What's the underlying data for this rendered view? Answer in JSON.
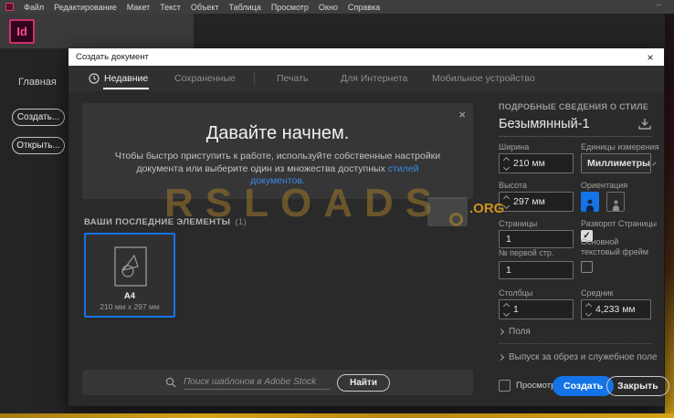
{
  "menubar": {
    "items": [
      "Файл",
      "Редактирование",
      "Макет",
      "Текст",
      "Объект",
      "Таблица",
      "Просмотр",
      "Окно",
      "Справка"
    ]
  },
  "app": {
    "logo_text": "Id"
  },
  "sidebar": {
    "home": "Главная",
    "create": "Создать...",
    "open": "Открыть..."
  },
  "dialog": {
    "title": "Создать документ",
    "tabs": [
      {
        "label": "Недавние"
      },
      {
        "label": "Сохраненные"
      },
      {
        "label": "Печать"
      },
      {
        "label": "Для Интернета"
      },
      {
        "label": "Мобильное устройство"
      }
    ],
    "hero": {
      "title": "Давайте начнем.",
      "body_line1": "Чтобы быстро приступить к работе, используйте собственные настройки",
      "body_line2": "документа или выберите один из множества доступных",
      "link_word1": "стилей",
      "link_word2": "документов."
    },
    "recents": {
      "section_label": "ВАШИ ПОСЛЕДНИЕ ЭЛЕМЕНТЫ",
      "count": "(1)",
      "item": {
        "name": "A4",
        "size": "210 мм x 297 мм"
      }
    },
    "search": {
      "placeholder": "Поиск шаблонов в Adobe Stock",
      "button": "Найти"
    },
    "panel": {
      "header": "ПОДРОБНЫЕ СВЕДЕНИЯ О СТИЛЕ",
      "doc_name": "Безымянный-1",
      "width_label": "Ширина",
      "width_value": "210 мм",
      "units_label": "Единицы измерения",
      "units_value": "Миллиметры",
      "height_label": "Высота",
      "height_value": "297 мм",
      "orientation_label": "Ориентация",
      "pages_label": "Страницы",
      "pages_value": "1",
      "facing_label": "Разворот Страницы",
      "start_label": "№ первой стр.",
      "start_value": "1",
      "frame_label": "Основной текстовый фрейм",
      "columns_label": "Столбцы",
      "columns_value": "1",
      "gutter_label": "Средник",
      "gutter_value": "4,233 мм",
      "margins_label": "Поля",
      "bleed_label": "Выпуск за обрез и служебное поле",
      "preview_label": "Просмотр",
      "create_button": "Создать",
      "close_button": "Закрыть"
    }
  },
  "watermark": {
    "text": "RSLOADS",
    "badge": ".ORG"
  },
  "icons": {
    "close_glyph": "×",
    "check_glyph": "✓",
    "minimize_glyph": "–"
  },
  "colors": {
    "accent_blue": "#1473e6",
    "link_blue": "#3a8ce8",
    "logo_pink": "#cf2f6e",
    "watermark_gold": "#c9931c"
  }
}
